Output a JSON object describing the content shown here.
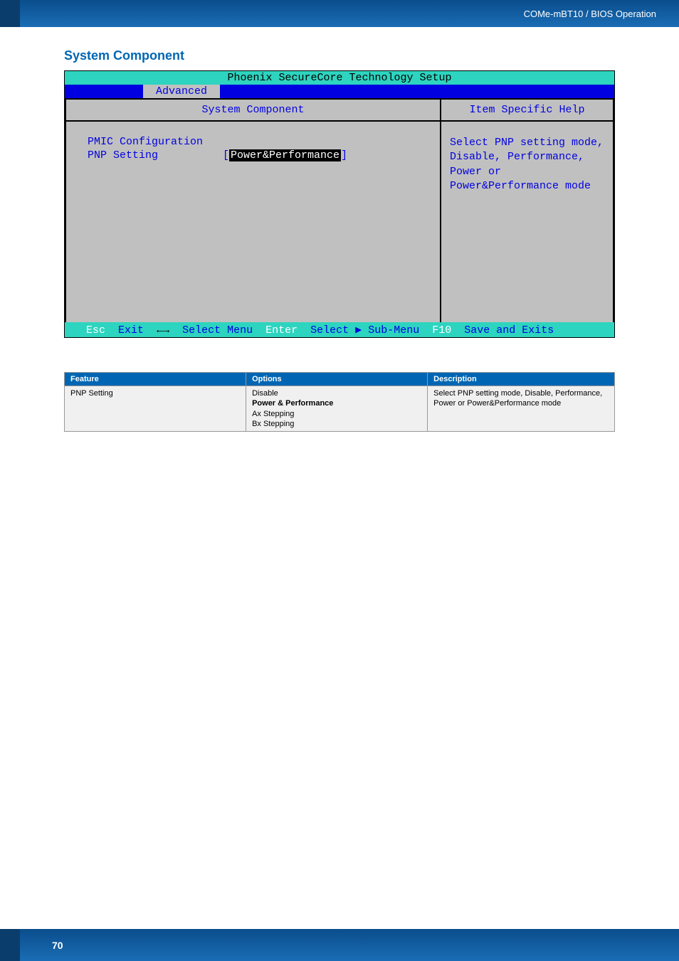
{
  "header": {
    "breadcrumb": "COMe-mBT10 / BIOS Operation"
  },
  "section_title": "System Component",
  "bios": {
    "title": "Phoenix SecureCore Technology Setup",
    "active_tab": "Advanced",
    "left_header": "System Component",
    "items": [
      {
        "label": "PMIC Configuration",
        "value": ""
      },
      {
        "label": "PNP Setting",
        "value": "Power&Performance"
      }
    ],
    "right_header": "Item Specific Help",
    "help_text": "Select PNP setting mode, Disable, Performance, Power or Power&Performance mode",
    "footer": {
      "esc_k": "Esc",
      "esc_v": "Exit",
      "arrows": "←→",
      "arrows_v": "Select Menu",
      "enter_k": "Enter",
      "enter_v": "Select ▶ Sub-Menu",
      "f10_k": "F10",
      "f10_v": "Save and Exits"
    }
  },
  "table": {
    "headers": [
      "Feature",
      "Options",
      "Description"
    ],
    "rows": [
      {
        "feature": "PNP Setting",
        "options": [
          "Disable",
          "Power & Performance",
          "Ax Stepping",
          "Bx Stepping"
        ],
        "bold_option_index": 1,
        "description": "Select PNP setting mode, Disable, Performance, Power or Power&Performance mode"
      }
    ]
  },
  "page_number": "70"
}
